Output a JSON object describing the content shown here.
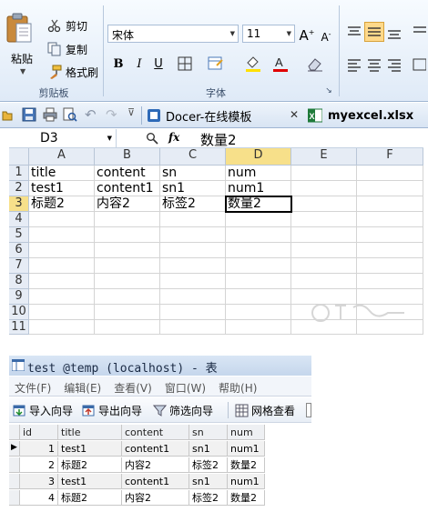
{
  "ribbon": {
    "clipboard": {
      "paste_label": "粘贴",
      "cut_label": "剪切",
      "copy_label": "复制",
      "format_painter_label": "格式刷",
      "group_label": "剪贴板"
    },
    "font": {
      "font_name": "宋体",
      "font_size": "11",
      "bold": "B",
      "italic": "I",
      "underline": "U",
      "group_label": "字体",
      "font_color": "#e00000",
      "highlight_color": "#ffe000"
    }
  },
  "tabs": {
    "docer_label": "Docer-在线模板",
    "file_label": "myexcel.xlsx"
  },
  "formula_bar": {
    "cell_ref": "D3",
    "fx_label": "fx",
    "value": "数量2"
  },
  "sheet": {
    "columns": [
      "A",
      "B",
      "C",
      "D",
      "E",
      "F"
    ],
    "rows": [
      "1",
      "2",
      "3",
      "4",
      "5",
      "6",
      "7",
      "8",
      "9",
      "10",
      "11"
    ],
    "cells": [
      [
        "title",
        "content",
        "sn",
        "num"
      ],
      [
        "test1",
        "content1",
        "sn1",
        "num1"
      ],
      [
        "标题2",
        "内容2",
        "标签2",
        "数量2"
      ]
    ],
    "selected_col": "D",
    "selected_row": "3"
  },
  "db_window": {
    "title": "test @temp (localhost) - 表",
    "menu": [
      "文件(F)",
      "编辑(E)",
      "查看(V)",
      "窗口(W)",
      "帮助(H)"
    ],
    "toolbar": {
      "import_label": "导入向导",
      "export_label": "导出向导",
      "filter_label": "筛选向导",
      "grid_view_label": "网格查看"
    },
    "columns": [
      "id",
      "title",
      "content",
      "sn",
      "num"
    ],
    "rows": [
      [
        "1",
        "test1",
        "content1",
        "sn1",
        "num1"
      ],
      [
        "2",
        "标题2",
        "内容2",
        "标签2",
        "数量2"
      ],
      [
        "3",
        "test1",
        "content1",
        "sn1",
        "num1"
      ],
      [
        "4",
        "标题2",
        "内容2",
        "标签2",
        "数量2"
      ]
    ]
  }
}
